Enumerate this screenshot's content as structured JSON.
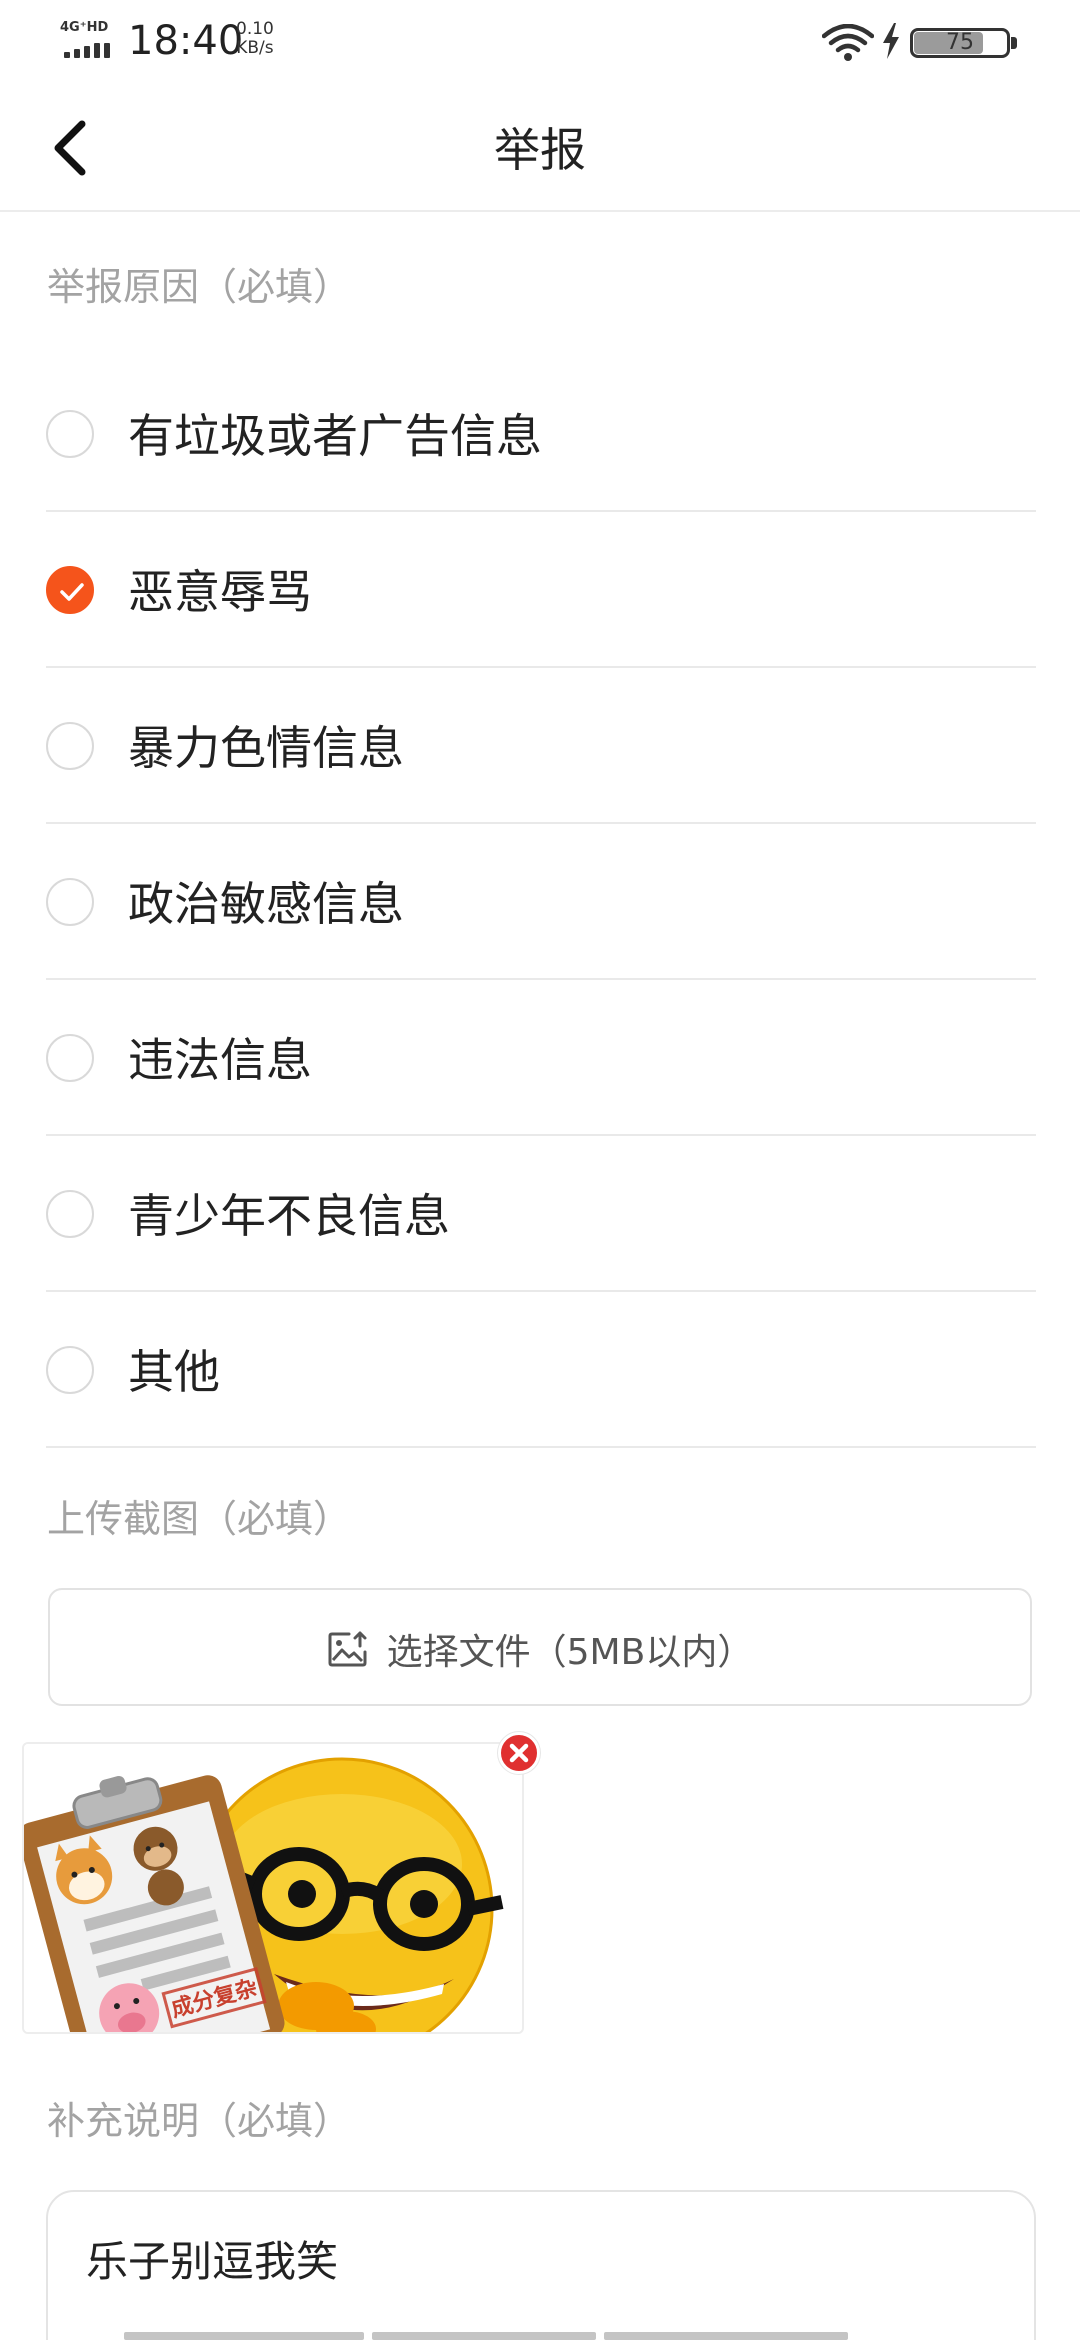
{
  "status_bar": {
    "network": "4G⁺HD",
    "time": "18:40",
    "speed_value": "0.10",
    "speed_unit": "KB/s",
    "battery_level": 75,
    "battery_text": "75",
    "icons": [
      "signal-icon",
      "wifi-icon",
      "charging-bolt-icon",
      "battery-icon"
    ]
  },
  "header": {
    "back_icon": "chevron-left-icon",
    "title": "举报"
  },
  "reason_section": {
    "label": "举报原因（必填）",
    "options": [
      {
        "label": "有垃圾或者广告信息",
        "checked": false
      },
      {
        "label": "恶意辱骂",
        "checked": true
      },
      {
        "label": "暴力色情信息",
        "checked": false
      },
      {
        "label": "政治敏感信息",
        "checked": false
      },
      {
        "label": "违法信息",
        "checked": false
      },
      {
        "label": "青少年不良信息",
        "checked": false
      },
      {
        "label": "其他",
        "checked": false
      }
    ],
    "accent_color": "#f5541b"
  },
  "upload_section": {
    "label": "上传截图（必填）",
    "button_label": "选择文件（5MB以内）",
    "button_icon": "image-upload-icon",
    "thumbnail_caption": "成分复杂",
    "delete_icon": "close-circle-icon"
  },
  "note_section": {
    "label": "补充说明（必填）",
    "value": "乐子别逗我笑"
  }
}
